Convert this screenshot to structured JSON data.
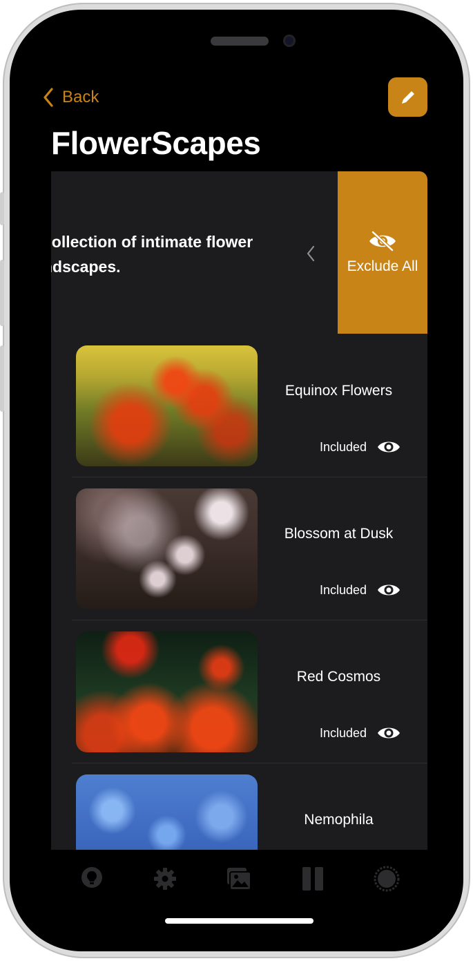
{
  "nav": {
    "back_label": "Back"
  },
  "page_title": "FlowerScapes",
  "description": {
    "line1": "collection of intimate flower",
    "line2": "ndscapes."
  },
  "swipe_action": {
    "label": "Exclude All",
    "icon": "eye-slash-icon"
  },
  "items": [
    {
      "title": "Equinox Flowers",
      "status": "Included",
      "status_icon": "eye-icon"
    },
    {
      "title": "Blossom at Dusk",
      "status": "Included",
      "status_icon": "eye-icon"
    },
    {
      "title": "Red Cosmos",
      "status": "Included",
      "status_icon": "eye-icon"
    },
    {
      "title": "Nemophila"
    }
  ],
  "tabbar": [
    "lightbulb-icon",
    "gear-icon",
    "photos-icon",
    "pause-icon",
    "circle-icon"
  ],
  "colors": {
    "accent": "#c98418",
    "background": "#000000",
    "panel": "#1c1c1e"
  }
}
